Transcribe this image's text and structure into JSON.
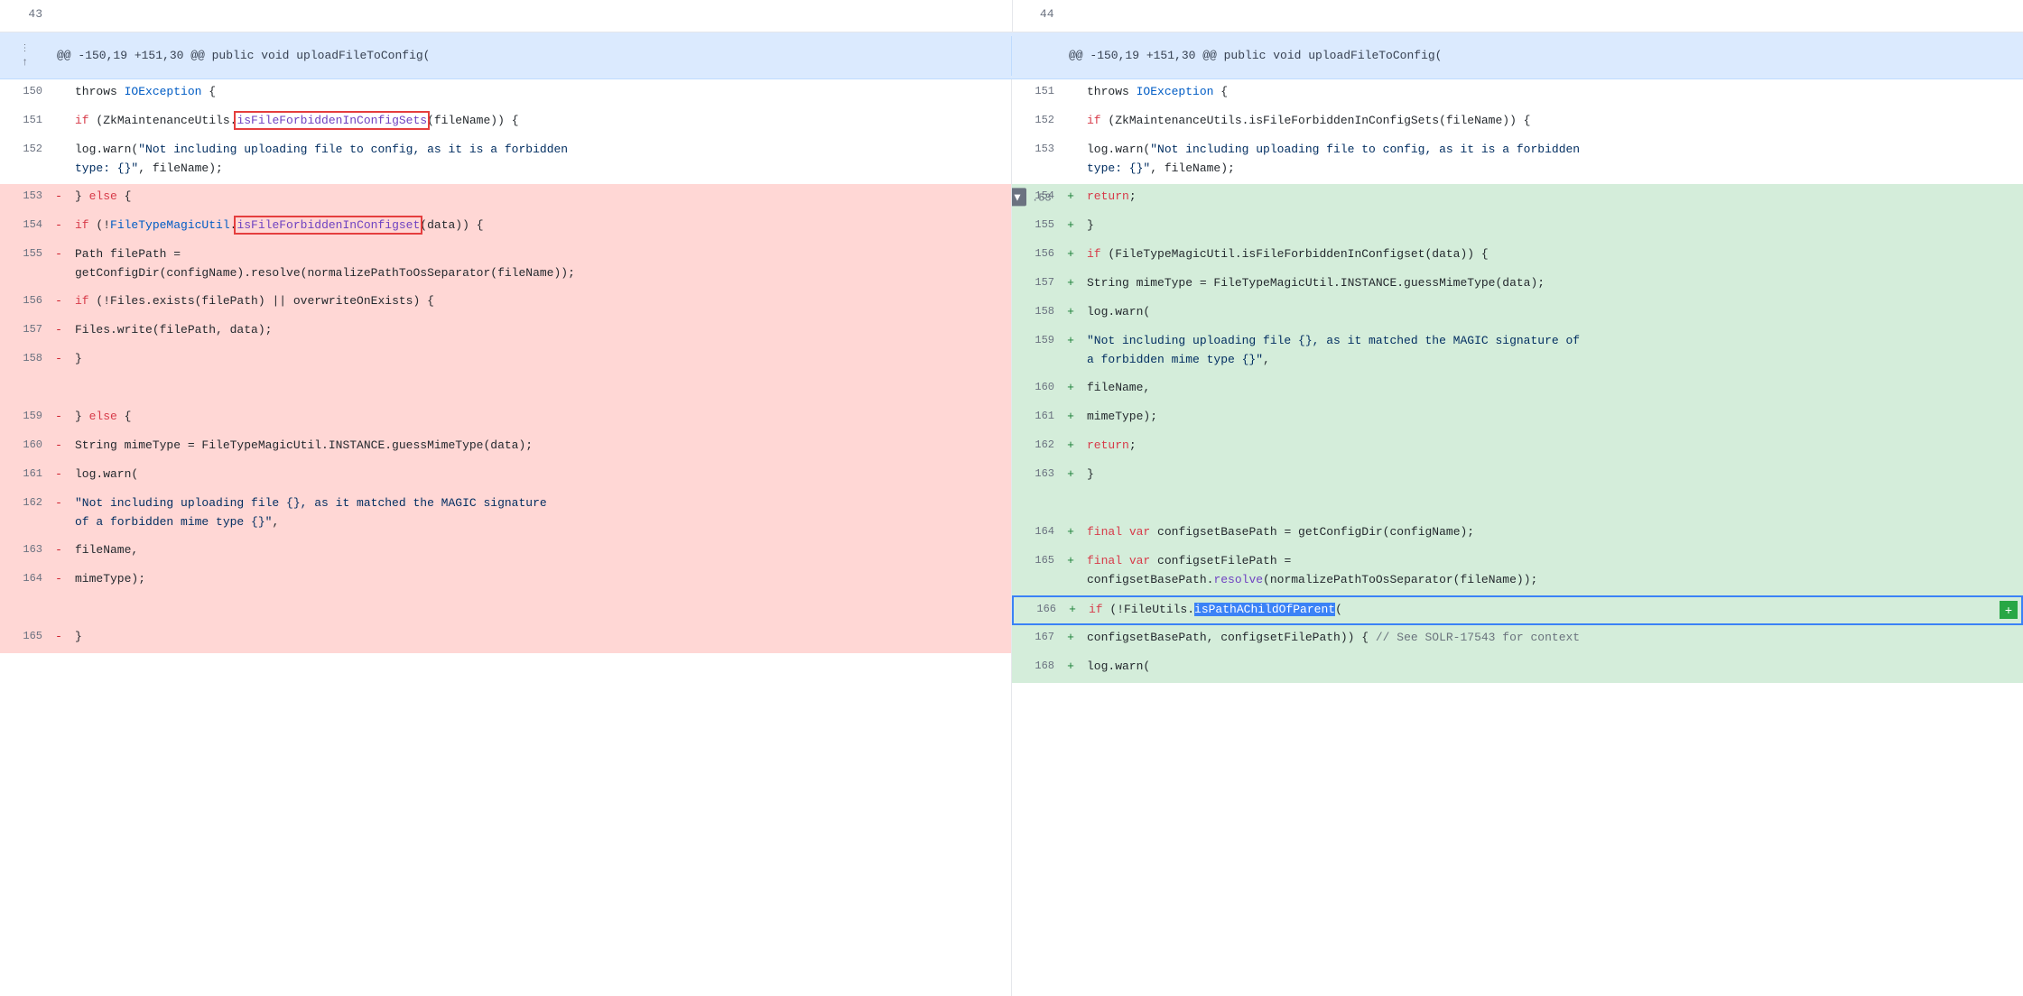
{
  "colors": {
    "removed_bg": "#ffd7d5",
    "added_bg": "#d4edda",
    "header_bg": "#dbeafe",
    "normal_bg": "#ffffff",
    "highlight_border": "#e53e3e",
    "selected_bg": "#3b82f6"
  },
  "header": {
    "context": "@@ -150,19 +151,30 @@ public void uploadFileToConfig(",
    "left_line_start": 43,
    "right_line_start": 44,
    "expand_up_label": "⋮",
    "expand_down_label": "↑"
  },
  "left_lines": [
    {
      "num": "150",
      "sign": "",
      "type": "normal",
      "code": "        throws IOException {"
    },
    {
      "num": "151",
      "sign": "",
      "type": "normal",
      "code": "        if (ZkMaintenanceUtils.isFileForbiddenInConfigSets(fileName)) {",
      "highlight1": true
    },
    {
      "num": "152",
      "sign": "",
      "type": "normal",
      "code": "            log.warn(\"Not including uploading file to config, as it is a forbidden"
    },
    {
      "num": "",
      "sign": "",
      "type": "normal",
      "code": "        type: {}\", fileName);"
    },
    {
      "num": "153",
      "sign": "-",
      "type": "removed",
      "code": "        } else {"
    },
    {
      "num": "154",
      "sign": "-",
      "type": "removed",
      "code": "            if (!FileTypeMagicUtil.isFileForbiddenInConfigset(data)) {",
      "highlight2": true
    },
    {
      "num": "155",
      "sign": "-",
      "type": "removed",
      "code": "                Path filePath ="
    },
    {
      "num": "",
      "sign": "",
      "type": "removed",
      "code": "        getConfigDir(configName).resolve(normalizePathToOsSeparator(fileName));"
    },
    {
      "num": "156",
      "sign": "-",
      "type": "removed",
      "code": "                if (!Files.exists(filePath) || overwriteOnExists) {"
    },
    {
      "num": "157",
      "sign": "-",
      "type": "removed",
      "code": "                    Files.write(filePath, data);"
    },
    {
      "num": "158",
      "sign": "-",
      "type": "removed",
      "code": "                }"
    },
    {
      "num": "",
      "sign": "",
      "type": "removed",
      "code": ""
    },
    {
      "num": "159",
      "sign": "-",
      "type": "removed",
      "code": "        } else {"
    },
    {
      "num": "160",
      "sign": "-",
      "type": "removed",
      "code": "                String mimeType = FileTypeMagicUtil.INSTANCE.guessMimeType(data);"
    },
    {
      "num": "161",
      "sign": "-",
      "type": "removed",
      "code": "                log.warn("
    },
    {
      "num": "162",
      "sign": "-",
      "type": "removed",
      "code": "                        \"Not including uploading file {}, as it matched the MAGIC signature"
    },
    {
      "num": "",
      "sign": "",
      "type": "removed",
      "code": "        of a forbidden mime type {}\","
    },
    {
      "num": "163",
      "sign": "-",
      "type": "removed",
      "code": "                        fileName,"
    },
    {
      "num": "164",
      "sign": "-",
      "type": "removed",
      "code": "                        mimeType);"
    },
    {
      "num": "",
      "sign": "",
      "type": "removed",
      "code": ""
    },
    {
      "num": "165",
      "sign": "-",
      "type": "removed",
      "code": "        }"
    }
  ],
  "right_lines": [
    {
      "num": "151",
      "sign": "",
      "type": "normal",
      "code": "        throws IOException {"
    },
    {
      "num": "152",
      "sign": "",
      "type": "normal",
      "code": "        if (ZkMaintenanceUtils.isFileForbiddenInConfigSets(fileName)) {"
    },
    {
      "num": "153",
      "sign": "",
      "type": "normal",
      "code": "            log.warn(\"Not including uploading file to config, as it is a forbidden"
    },
    {
      "num": "",
      "sign": "",
      "type": "normal",
      "code": "        type: {}\", fileName);"
    },
    {
      "num": "154",
      "sign": "+",
      "type": "added",
      "code": "            return;"
    },
    {
      "num": "155",
      "sign": "+",
      "type": "added",
      "code": "        }"
    },
    {
      "num": "156",
      "sign": "+",
      "type": "added",
      "code": "        if (FileTypeMagicUtil.isFileForbiddenInConfigset(data)) {"
    },
    {
      "num": "157",
      "sign": "+",
      "type": "added",
      "code": "            String mimeType = FileTypeMagicUtil.INSTANCE.guessMimeType(data);"
    },
    {
      "num": "158",
      "sign": "+",
      "type": "added",
      "code": "            log.warn("
    },
    {
      "num": "159",
      "sign": "+",
      "type": "added",
      "code": "                    \"Not including uploading file {}, as it matched the MAGIC signature of"
    },
    {
      "num": "",
      "sign": "",
      "type": "added",
      "code": "        a forbidden mime type {}\","
    },
    {
      "num": "160",
      "sign": "+",
      "type": "added",
      "code": "                    fileName,"
    },
    {
      "num": "161",
      "sign": "+",
      "type": "added",
      "code": "                    mimeType);"
    },
    {
      "num": "162",
      "sign": "+",
      "type": "added",
      "code": "            return;"
    },
    {
      "num": "163",
      "sign": "+",
      "type": "added",
      "code": "        }"
    },
    {
      "num": "",
      "sign": "",
      "type": "added",
      "code": ""
    },
    {
      "num": "164",
      "sign": "+",
      "type": "added",
      "code": "        final var configsetBasePath = getConfigDir(configName);"
    },
    {
      "num": "165",
      "sign": "+",
      "type": "added",
      "code": "        final var configsetFilePath ="
    },
    {
      "num": "",
      "sign": "",
      "type": "added",
      "code": "        configsetBasePath.resolve(normalizePathToOsSeparator(fileName));"
    },
    {
      "num": "166",
      "sign": "+",
      "type": "added",
      "code": "        if (!FileUtils.isPathAChildOfParent(",
      "selected": true
    },
    {
      "num": "167",
      "sign": "+",
      "type": "added",
      "code": "                configsetBasePath, configsetFilePath)) { // See SOLR-17543 for context"
    },
    {
      "num": "168",
      "sign": "+",
      "type": "added",
      "code": "            log.warn("
    }
  ],
  "separator": {
    "line153_label": "+",
    "line153_expand": "▼"
  }
}
